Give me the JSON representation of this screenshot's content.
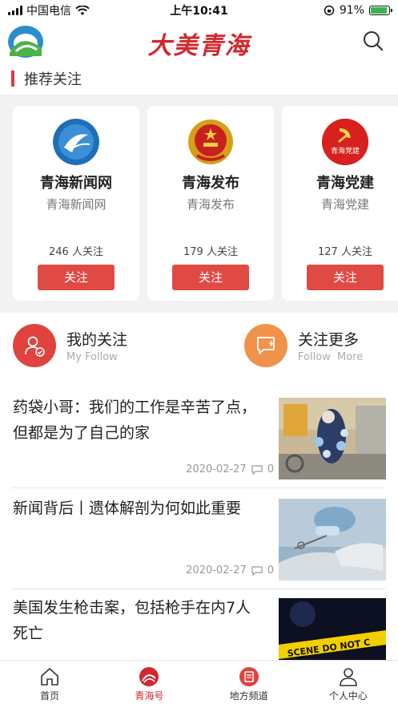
{
  "status_bar": {
    "carrier": "中国电信",
    "time": "上午10:41",
    "battery": "91%",
    "battery_level": 0.91
  },
  "header": {
    "brand": "大美青海",
    "search_icon": "search-icon"
  },
  "section": {
    "title": "推荐关注"
  },
  "cards": [
    {
      "name": "青海新闻网",
      "sub": "青海新闻网",
      "followers": "246 人关注",
      "button": "关注"
    },
    {
      "name": "青海发布",
      "sub": "青海发布",
      "followers": "179 人关注",
      "button": "关注"
    },
    {
      "name": "青海党建",
      "sub": "青海党建",
      "followers": "127 人关注",
      "button": "关注",
      "badge": "青海党建"
    }
  ],
  "follow": {
    "mine": {
      "title": "我的关注",
      "en": "My Follow"
    },
    "more": {
      "title": "关注更多",
      "en": "Follow  More"
    }
  },
  "news": [
    {
      "title": "药袋小哥：我们的工作是辛苦了点，但都是为了自己的家",
      "date": "2020-02-27",
      "comments": "0"
    },
    {
      "title": "新闻背后丨遗体解剖为何如此重要",
      "date": "2020-02-27",
      "comments": "0"
    },
    {
      "title": "美国发生枪击案，包括枪手在内7人死亡",
      "date": "",
      "comments": ""
    }
  ],
  "tabs": [
    {
      "label": "首页",
      "icon": "home-icon"
    },
    {
      "label": "青海号",
      "icon": "qinghai-hao-icon",
      "active": true
    },
    {
      "label": "地方频道",
      "icon": "local-channel-icon"
    },
    {
      "label": "个人中心",
      "icon": "user-icon"
    }
  ],
  "colors": {
    "brand_red": "#d2282e",
    "button_red": "#e04a45",
    "more_orange": "#f0924a"
  }
}
